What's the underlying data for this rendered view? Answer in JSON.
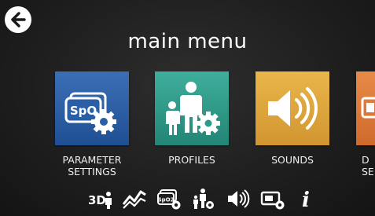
{
  "header": {
    "title": "main menu",
    "back_icon": "arrow-left-icon"
  },
  "tiles": [
    {
      "label": "PARAMETER SETTINGS",
      "line1": "PARAMETER",
      "line2": "SETTINGS",
      "icon": "spo2-settings-icon",
      "badge": "SpO",
      "color": "#2a5fa8"
    },
    {
      "label": "PROFILES",
      "icon": "profiles-icon",
      "color": "#2b9b8a"
    },
    {
      "label": "SOUNDS",
      "icon": "speaker-icon",
      "color": "#d9a23a"
    },
    {
      "label_partial_line1": "D",
      "label_partial_line2": "SE",
      "icon": "display-icon",
      "color": "#d9773a"
    }
  ],
  "bottom_bar": {
    "items": [
      {
        "icon": "3d-view-icon",
        "text": "3D"
      },
      {
        "icon": "trends-icon"
      },
      {
        "icon": "spo2-settings-icon",
        "text": "SpO2"
      },
      {
        "icon": "profiles-icon"
      },
      {
        "icon": "speaker-icon"
      },
      {
        "icon": "display-settings-icon"
      },
      {
        "icon": "info-icon",
        "text": "i"
      }
    ]
  }
}
